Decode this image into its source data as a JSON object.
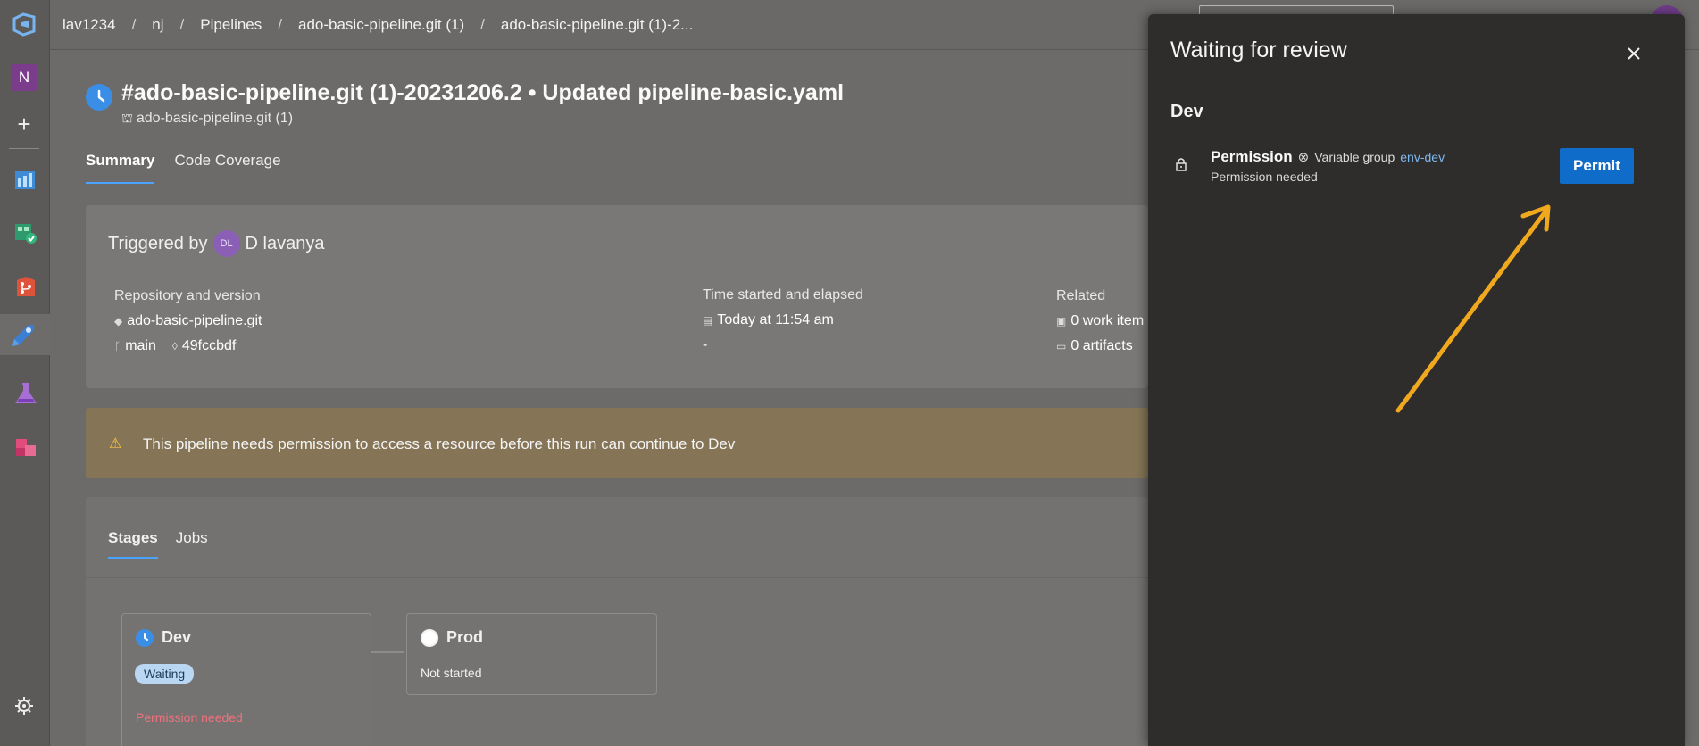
{
  "breadcrumbs": [
    "lav1234",
    "nj",
    "Pipelines",
    "ado-basic-pipeline.git (1)",
    "ado-basic-pipeline.git (1)-2..."
  ],
  "rail": {
    "project_initial": "N",
    "services": [
      "overview-icon",
      "boards-icon",
      "repos-icon",
      "pipelines-icon",
      "test-plans-icon",
      "artifacts-icon"
    ]
  },
  "run": {
    "title": "#ado-basic-pipeline.git (1)-20231206.2 • Updated pipeline-basic.yaml",
    "pipeline_name": "ado-basic-pipeline.git (1)",
    "status_color": "#3a8ee6"
  },
  "tabs": [
    "Summary",
    "Code Coverage"
  ],
  "summary": {
    "triggered_by_label": "Triggered by",
    "user_initials": "DL",
    "user_name": "D lavanya",
    "repo_label": "Repository and version",
    "repo_name": "ado-basic-pipeline.git",
    "branch": "main",
    "commit": "49fccbdf",
    "time_label": "Time started and elapsed",
    "time_started": "Today at 11:54 am",
    "elapsed": "-",
    "related_label": "Related",
    "work_items": "0 work item",
    "artifacts": "0 artifacts"
  },
  "banner": {
    "message": "This pipeline needs permission to access a resource before this run can continue to Dev",
    "color": "#857556"
  },
  "stages_tabs": [
    "Stages",
    "Jobs"
  ],
  "stages": [
    {
      "name": "Dev",
      "badge": "Waiting",
      "note": "Permission needed"
    },
    {
      "name": "Prod",
      "status": "Not started"
    }
  ],
  "review_panel": {
    "title": "Waiting for review",
    "stage": "Dev",
    "check_name": "Permission",
    "resource_type": "Variable group",
    "resource_name": "env-dev",
    "status": "Permission needed",
    "button_label": "Permit",
    "button_color": "#0f6cc8"
  },
  "annotation": {
    "arrow_color": "#f0a81e"
  }
}
